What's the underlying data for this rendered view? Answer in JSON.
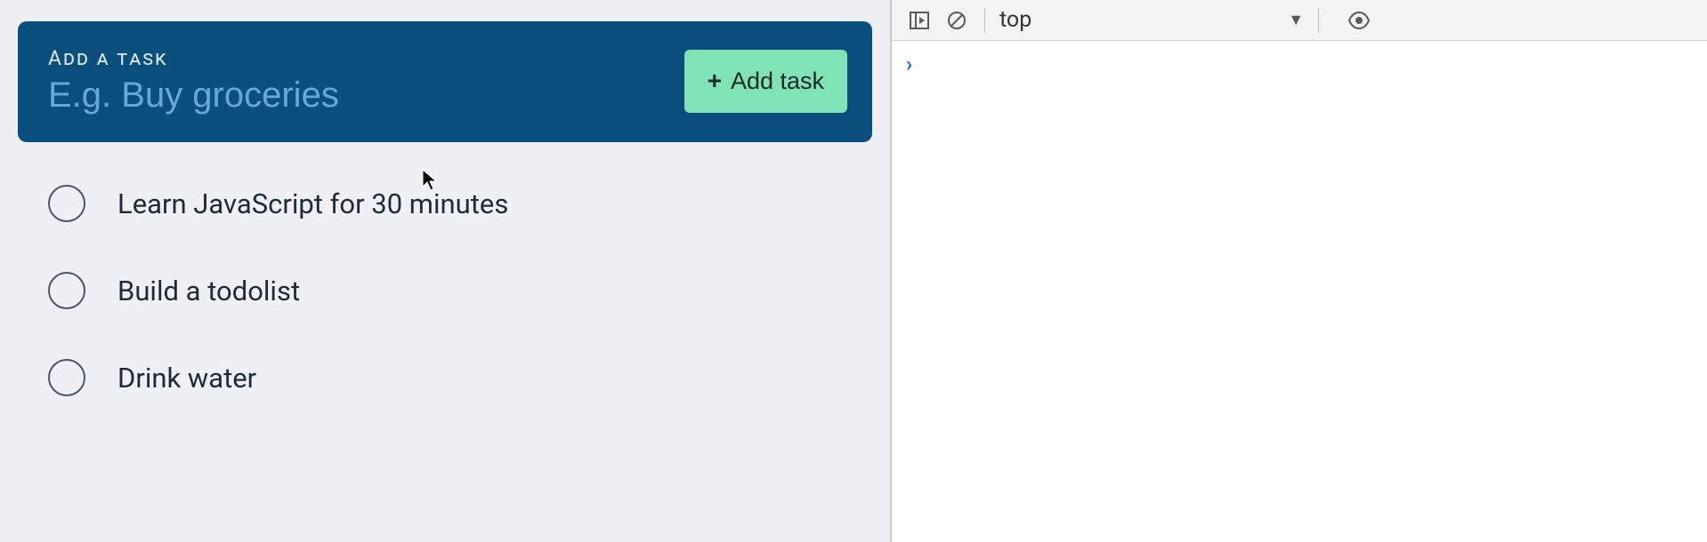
{
  "addTask": {
    "label": "Add a task",
    "placeholder": "E.g. Buy groceries",
    "value": "",
    "buttonLabel": "Add task"
  },
  "tasks": [
    {
      "text": "Learn JavaScript for 30 minutes",
      "done": false
    },
    {
      "text": "Build a todolist",
      "done": false
    },
    {
      "text": "Drink water",
      "done": false
    }
  ],
  "devtools": {
    "context": "top",
    "prompt": "›"
  }
}
